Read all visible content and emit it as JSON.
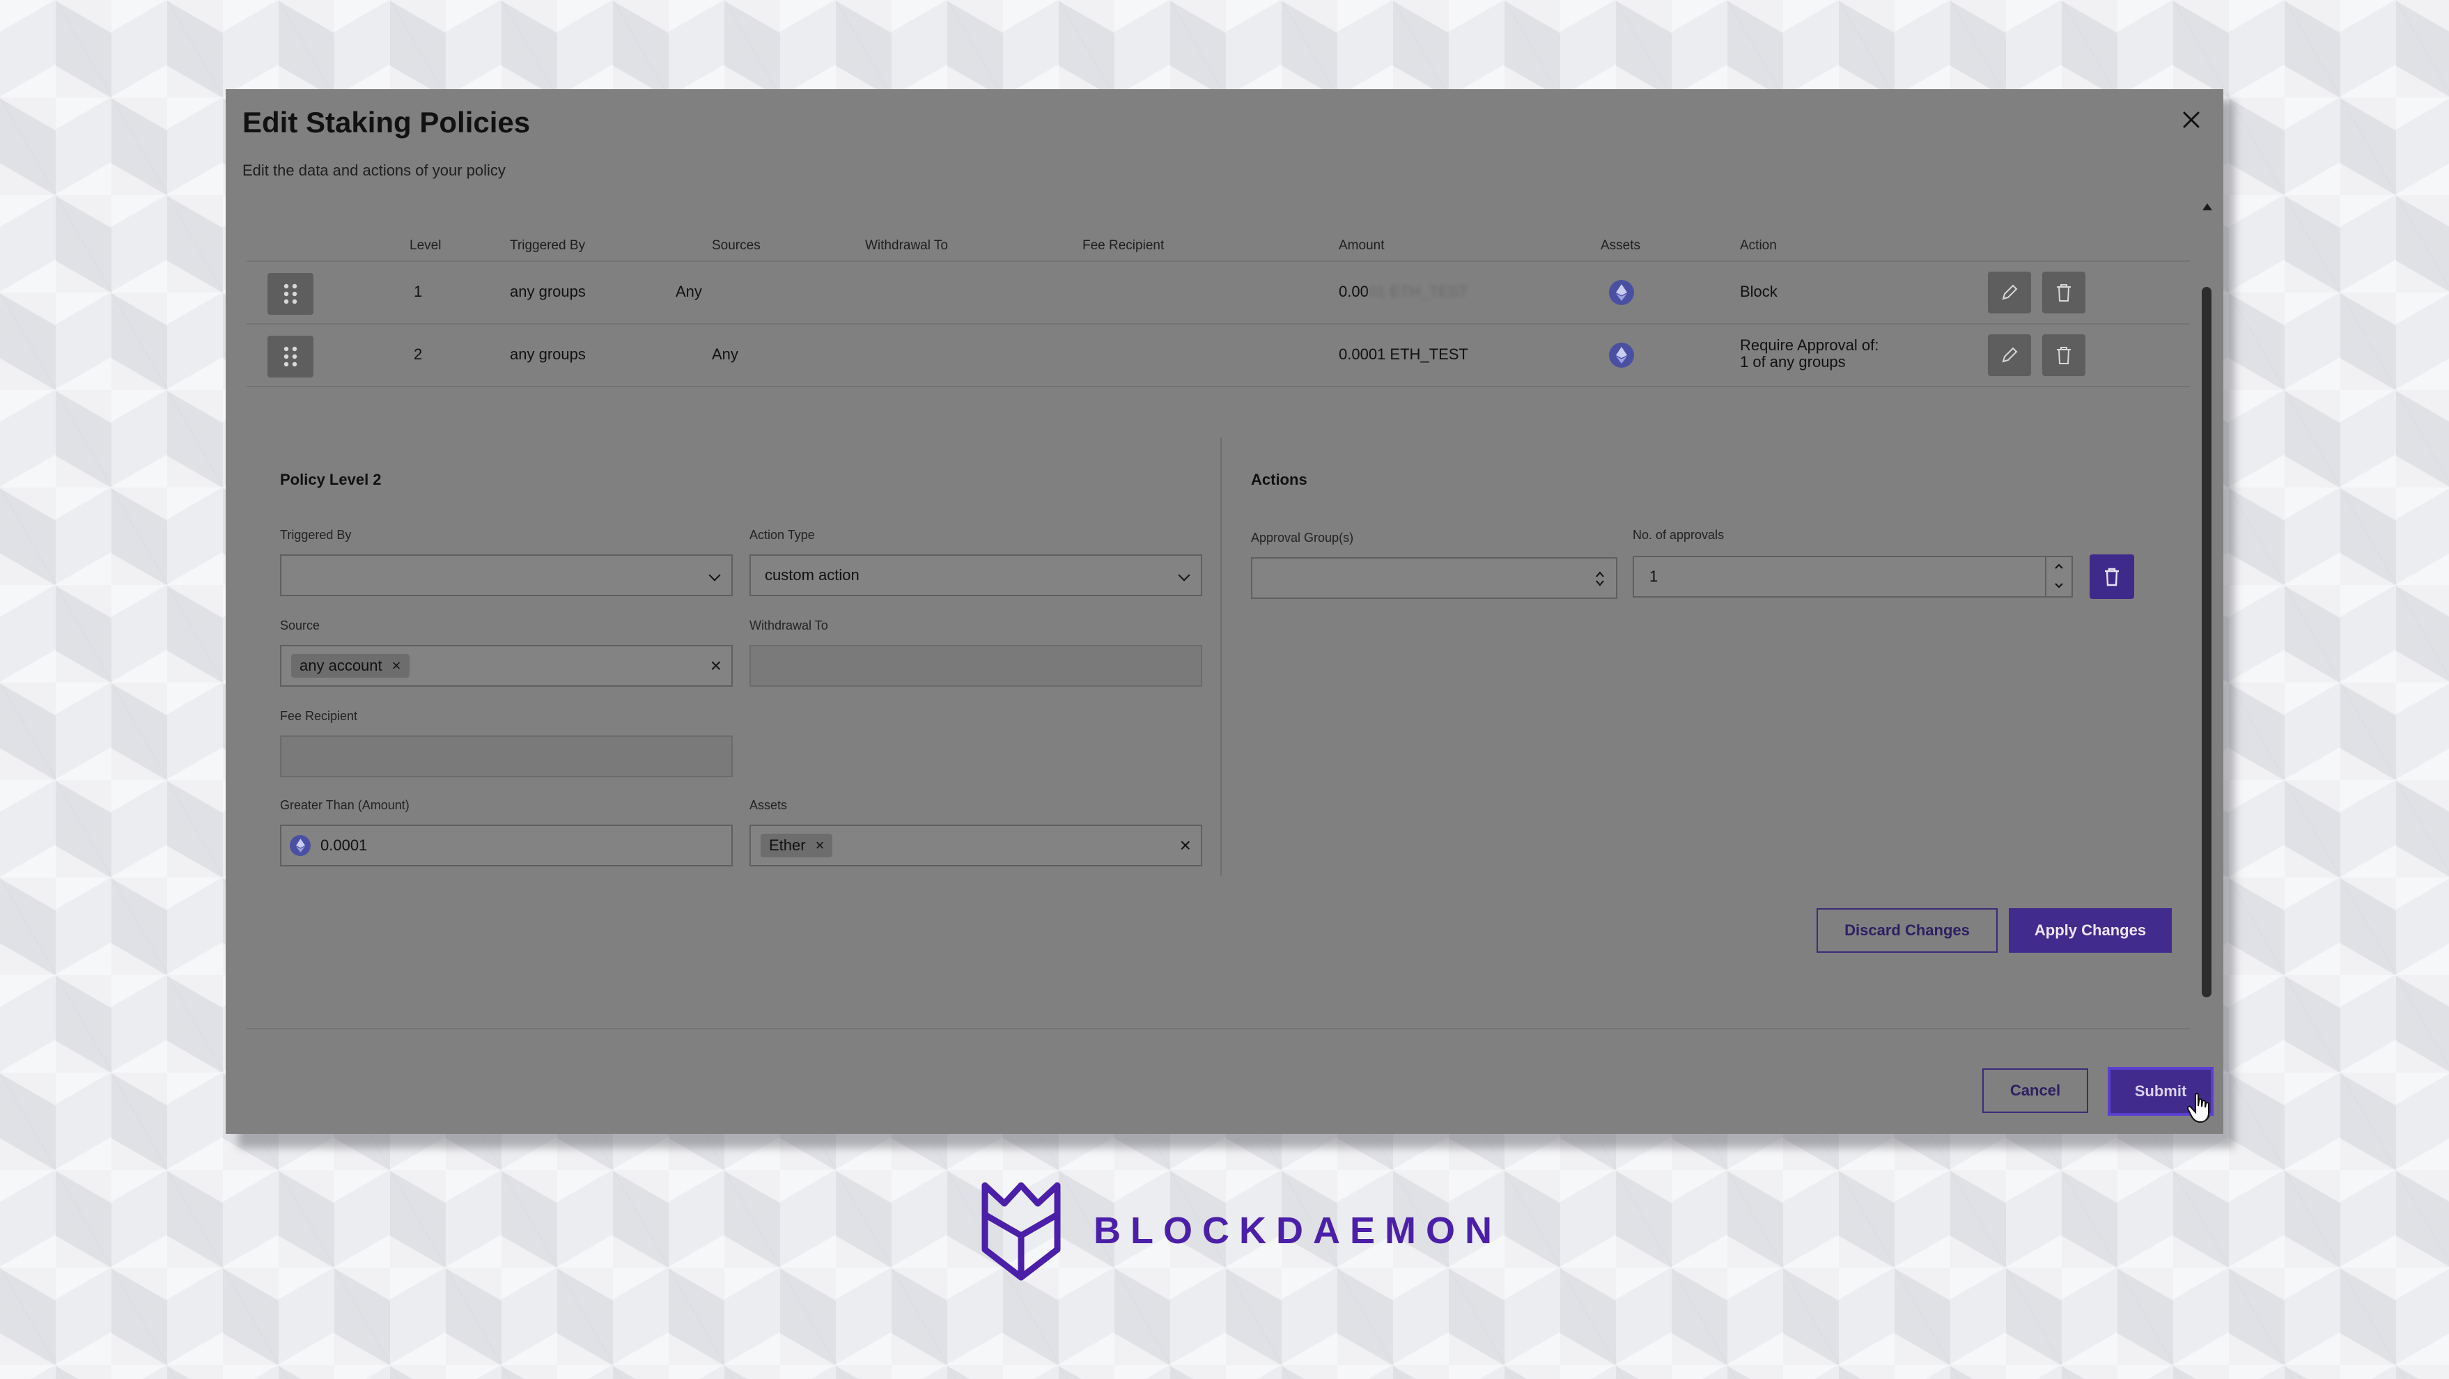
{
  "modal": {
    "title": "Edit Staking Policies",
    "subtitle": "Edit the data and actions of your policy"
  },
  "table": {
    "headers": [
      "Level",
      "Triggered By",
      "Sources",
      "Withdrawal To",
      "Fee Recipient",
      "Amount",
      "Assets",
      "Action"
    ],
    "rows": [
      {
        "level": "1",
        "triggered_by": "any groups",
        "sources": "Any",
        "amount": "0.00",
        "amount_blurred": "01 ETH_TEST",
        "action": "Block",
        "action_line2": ""
      },
      {
        "level": "2",
        "triggered_by": "any groups",
        "sources": "Any",
        "amount": "0.0001 ETH_TEST",
        "amount_blurred": "",
        "action": "Require Approval of:",
        "action_line2": "1 of any groups"
      }
    ]
  },
  "policy": {
    "title": "Policy Level 2",
    "triggered_by_label": "Triggered By",
    "triggered_by_value": "",
    "action_type_label": "Action Type",
    "action_type_value": "custom action",
    "source_label": "Source",
    "source_chip": "any account",
    "withdrawal_to_label": "Withdrawal To",
    "fee_recipient_label": "Fee Recipient",
    "amount_label": "Greater Than (Amount)",
    "amount_value": "0.0001",
    "assets_label": "Assets",
    "assets_chip": "Ether"
  },
  "actions": {
    "title": "Actions",
    "approval_groups_label": "Approval Group(s)",
    "approvals_label": "No. of approvals",
    "approvals_value": "1",
    "discard_label": "Discard Changes",
    "apply_label": "Apply Changes"
  },
  "footer": {
    "cancel_label": "Cancel",
    "submit_label": "Submit"
  },
  "brand": {
    "name": "BLOCKDAEMON",
    "color": "#4b1fa8"
  },
  "colors": {
    "accent": "#412b8c",
    "overlay": "#808080",
    "asset_icon": "#4a4fa2"
  }
}
